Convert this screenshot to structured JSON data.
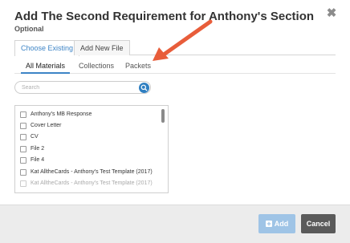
{
  "modal": {
    "title": "Add The Second Requirement for Anthony's Section",
    "subtitle": "Optional"
  },
  "outer_tabs": [
    {
      "label": "Choose Existing",
      "active": true
    },
    {
      "label": "Add New File",
      "active": false
    }
  ],
  "inner_tabs": [
    {
      "label": "All Materials",
      "active": true
    },
    {
      "label": "Collections",
      "active": false
    },
    {
      "label": "Packets",
      "active": false
    }
  ],
  "search": {
    "placeholder": "Search",
    "icon": "search-icon"
  },
  "materials": [
    {
      "label": "Anthony's MB Response",
      "checked": false
    },
    {
      "label": "Cover Letter",
      "checked": false
    },
    {
      "label": "CV",
      "checked": false
    },
    {
      "label": "File 2",
      "checked": false
    },
    {
      "label": "File 4",
      "checked": false
    },
    {
      "label": "Kat AlltheCards - Anthony's Test Template (2017)",
      "checked": false
    },
    {
      "label": "Kat AlltheCards - Anthony's Test Template (2017)",
      "checked": false
    }
  ],
  "footer": {
    "add_label": "Add",
    "cancel_label": "Cancel"
  },
  "colors": {
    "accent": "#3d84c6",
    "add_button": "#9fc4e6",
    "cancel_button": "#5a5a5a",
    "annotation_arrow": "#e85d3a"
  }
}
